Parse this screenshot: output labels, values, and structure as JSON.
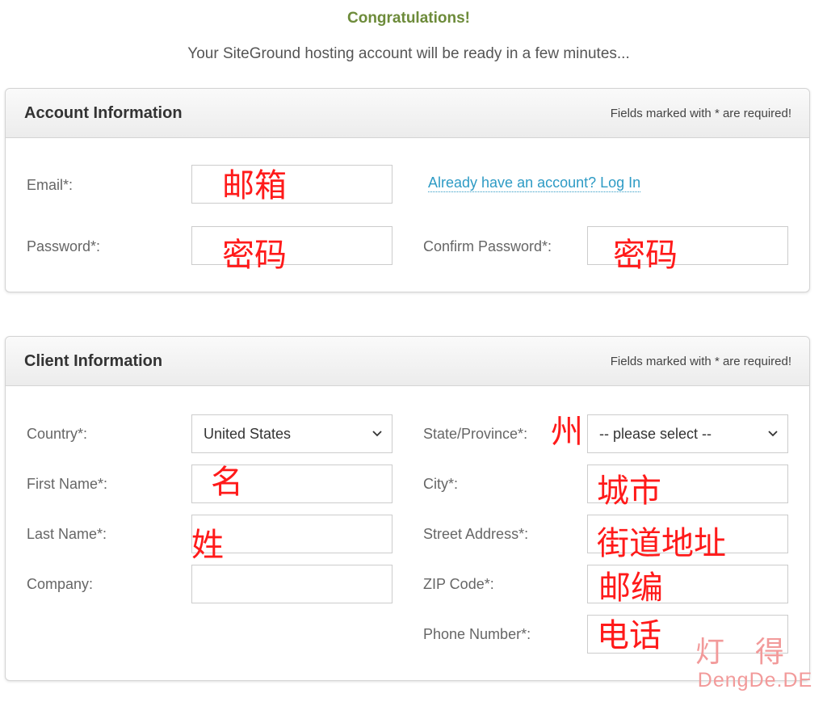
{
  "header": {
    "congrats": "Congratulations!",
    "subtitle": "Your SiteGround hosting account will be ready in a few minutes..."
  },
  "account": {
    "title": "Account Information",
    "required_note": "Fields marked with * are required!",
    "email_label": "Email*:",
    "email_annotation": "邮箱",
    "login_link": "Already have an account? Log In",
    "password_label": "Password*:",
    "password_annotation": "密码",
    "confirm_password_label": "Confirm Password*:",
    "confirm_password_annotation": "密码"
  },
  "client": {
    "title": "Client Information",
    "required_note": "Fields marked with * are required!",
    "country_label": "Country*:",
    "country_value": "United States",
    "state_label": "State/Province*:",
    "state_annotation": "州",
    "state_value": "-- please select --",
    "first_name_label": "First Name*:",
    "first_name_annotation": "名",
    "city_label": "City*:",
    "city_annotation": "城市",
    "last_name_label": "Last Name*:",
    "last_name_annotation": "姓",
    "street_label": "Street Address*:",
    "street_annotation": "街道地址",
    "company_label": "Company:",
    "zip_label": "ZIP Code*:",
    "zip_annotation": "邮编",
    "phone_label": "Phone Number*:",
    "phone_annotation": "电话"
  },
  "watermark": {
    "chinese": "灯得",
    "latin": "DengDe.DE"
  },
  "colors": {
    "congrats": "#6d8b3a",
    "link": "#2e9bc5",
    "annotation": "#ff1a1a",
    "watermark": "#f29a9a"
  },
  "icons": {
    "select_chevron": "chevron-down-icon"
  }
}
